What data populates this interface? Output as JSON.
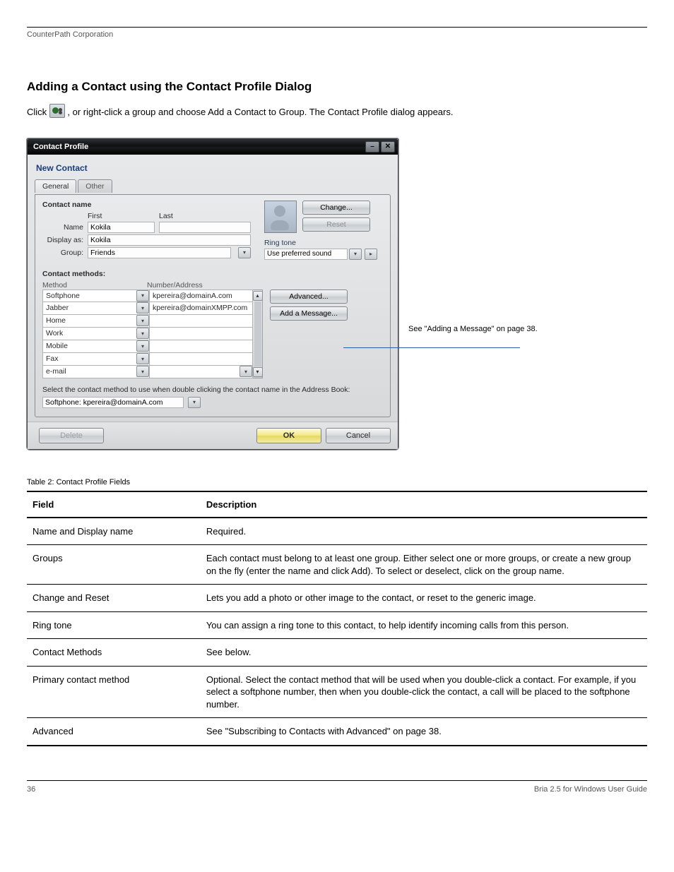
{
  "doc": {
    "header_left": "CounterPath Corporation",
    "section_title": "Adding a Contact using the Contact Profile Dialog",
    "intro_line1_prefix": "Click ",
    "intro_line1_suffix": ", or right-click a group and choose Add a Contact to Group. The Contact Profile dialog appears.",
    "footer_left": "36",
    "footer_right": "Bria 2.5 for Windows User Guide"
  },
  "dialog": {
    "title": "Contact Profile",
    "new_contact": "New Contact",
    "tabs": {
      "general": "General",
      "other": "Other"
    },
    "contact_name_label": "Contact name",
    "first_label": "First",
    "last_label": "Last",
    "name_label": "Name",
    "name_value": "Kokila",
    "display_as_label": "Display as:",
    "display_as_value": "Kokila",
    "group_label": "Group:",
    "group_value": "Friends",
    "change_btn": "Change...",
    "reset_btn": "Reset",
    "ringtone_label": "Ring tone",
    "ringtone_value": "Use preferred sound",
    "contact_methods_label": "Contact methods:",
    "col_method": "Method",
    "col_addr": "Number/Address",
    "methods": [
      {
        "method": "Softphone",
        "addr": "kpereira@domainA.com"
      },
      {
        "method": "Jabber",
        "addr": "kpereira@domainXMPP.com"
      },
      {
        "method": "Home",
        "addr": ""
      },
      {
        "method": "Work",
        "addr": ""
      },
      {
        "method": "Mobile",
        "addr": ""
      },
      {
        "method": "Fax",
        "addr": ""
      },
      {
        "method": "e-mail",
        "addr": ""
      }
    ],
    "advanced_btn": "Advanced...",
    "add_msg_btn": "Add a Message...",
    "select_text": "Select the contact method to use when double clicking the contact name in the Address Book:",
    "primary_value": "Softphone: kpereira@domainA.com",
    "delete_btn": "Delete",
    "ok_btn": "OK",
    "cancel_btn": "Cancel"
  },
  "callout": {
    "text": "See \"Adding a Message\" on page 38."
  },
  "fields_table": {
    "caption": "Table 2: Contact Profile Fields",
    "col1": "Field",
    "col2": "Description",
    "rows": [
      {
        "f": "Name and Display name",
        "d": "Required."
      },
      {
        "f": "Groups",
        "d": "Each contact must belong to at least one group. Either select one or more groups, or create a new group on the fly (enter the name and click Add). To select or deselect, click on the group name."
      },
      {
        "f": "Change and Reset",
        "d": "Lets you add a photo or other image to the contact, or reset to the generic image."
      },
      {
        "f": "Ring tone",
        "d": "You can assign a ring tone to this contact, to help identify incoming calls from this person."
      },
      {
        "f": "Contact Methods",
        "d": "See below."
      },
      {
        "f": "Primary contact method",
        "d": "Optional. Select the contact method that will be used when you double-click a contact. For example, if you select a softphone number, then when you double-click the contact, a call will be placed to the softphone number."
      },
      {
        "f": "Advanced",
        "d": "See \"Subscribing to Contacts with Advanced\" on page 38."
      }
    ]
  }
}
